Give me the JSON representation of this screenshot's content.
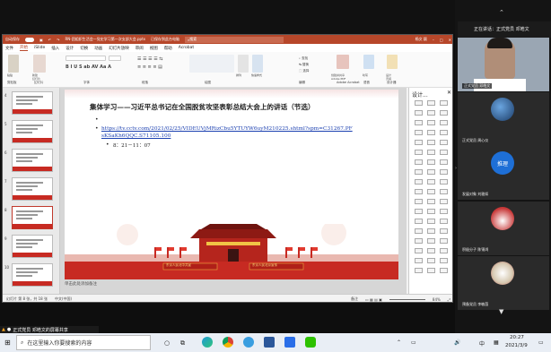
{
  "ppt": {
    "autosave": "自动保存",
    "file_name": "RN-团组织生活会—党史学习第一次支部大会.pptx",
    "saved": "已保存到此台电脑",
    "search_placeholder": "搜索",
    "user": "杨文 颖",
    "tabs": [
      "文件",
      "开始",
      "iSlide",
      "插入",
      "设计",
      "切换",
      "动画",
      "幻灯片放映",
      "审阅",
      "视图",
      "帮助",
      "Acrobat"
    ],
    "active_tab": "开始",
    "ribbon_groups": [
      "剪贴板",
      "幻灯片",
      "字体",
      "段落",
      "绘图",
      "编辑",
      "Adobe Acrobat",
      "语音",
      "设计器"
    ],
    "ribbon_big": [
      "粘贴",
      "新建\n幻灯片",
      "排列",
      "快速样式",
      "创建并共享\nAdobe PDF",
      "听写",
      "设计\n灵感"
    ],
    "thumbs": [
      "4",
      "5",
      "6",
      "7",
      "8",
      "9",
      "10"
    ],
    "selected_thumb": "8",
    "notes_placeholder": "单击此处添加备注",
    "status_slide": "幻灯片 第 8 张，共 18 张",
    "status_lang": "中文(中国)",
    "status_notes": "备注",
    "zoom": "84%",
    "taskpane_title": "设计..."
  },
  "slide": {
    "title": "集体学习——习近平总书记在全国脱贫攻坚表彰总结大会上的讲话（节选）",
    "link1": "https://tv.cctv.com/2021/02/25/VIDEUVjMRizCbu5YTUYW6uyM210225.shtml?spm=C31267.PF",
    "link2": "sKSaKh6QQC.S71105.100",
    "time": "8：21－11：07",
    "banner_left": "东京人民北中共宣",
    "banner_right": "东京人民北京宣传"
  },
  "meeting": {
    "status": "正在讲话：正式党员 邓皓文",
    "participants": [
      {
        "name": "正式党员 邓皓文"
      },
      {
        "name": "正式党员 周心仪"
      },
      {
        "name": "发展对象 刘雅如"
      },
      {
        "name": "积极分子 陈锦鸿"
      },
      {
        "name": "预备党员 李敏茵"
      }
    ],
    "avatar_text": "推理",
    "share_label": "正式党员 邓皓文的屏幕共享"
  },
  "taskbar": {
    "search_placeholder": "在这里输入你要搜索的内容",
    "time": "20:27",
    "date": "2021/3/9",
    "ime": "中"
  }
}
